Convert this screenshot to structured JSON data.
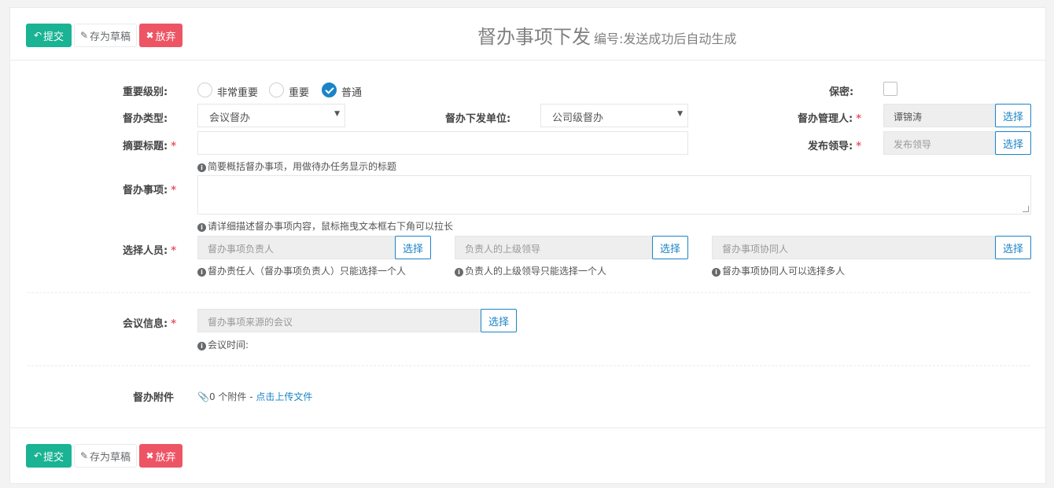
{
  "toolbar": {
    "submit_label": "提交",
    "draft_label": "存为草稿",
    "discard_label": "放弃"
  },
  "header": {
    "title": "督办事项下发",
    "subtitle": "编号:发送成功后自动生成"
  },
  "form": {
    "importance": {
      "label": "重要级别:",
      "options": [
        "非常重要",
        "重要",
        "普通"
      ],
      "selected": "普通"
    },
    "confidential": {
      "label": "保密:",
      "checked": false
    },
    "supervise_type": {
      "label": "督办类型:",
      "value": "会议督办"
    },
    "issuing_unit": {
      "label": "督办下发单位:",
      "value": "公司级督办"
    },
    "manager": {
      "label": "督办管理人:",
      "value": "谭锦涛",
      "button": "选择"
    },
    "summary_title": {
      "label": "摘要标题:",
      "value": "",
      "help": "简要概括督办事项，用做待办任务显示的标题"
    },
    "publish_leader": {
      "label": "发布领导:",
      "placeholder": "发布领导",
      "button": "选择"
    },
    "matter": {
      "label": "督办事项:",
      "value": "",
      "help": "请详细描述督办事项内容，鼠标拖曳文本框右下角可以拉长"
    },
    "personnel": {
      "label": "选择人员:",
      "responsible": {
        "placeholder": "督办事项负责人",
        "button": "选择",
        "help": "督办责任人（督办事项负责人）只能选择一个人"
      },
      "superior": {
        "placeholder": "负责人的上级领导",
        "button": "选择",
        "help": "负责人的上级领导只能选择一个人"
      },
      "collaborators": {
        "placeholder": "督办事项协同人",
        "button": "选择",
        "help": "督办事项协同人可以选择多人"
      }
    },
    "meeting": {
      "label": "会议信息:",
      "placeholder": "督办事项来源的会议",
      "button": "选择",
      "help": "会议时间:"
    },
    "attachments": {
      "label": "督办附件",
      "count_text": "0 个附件 - ",
      "upload_link": "点击上传文件"
    }
  },
  "footer": {
    "submit_label": "提交",
    "draft_label": "存为草稿",
    "discard_label": "放弃"
  },
  "colors": {
    "primary": "#1ab394",
    "danger": "#ed5565",
    "link": "#1c84c6"
  }
}
